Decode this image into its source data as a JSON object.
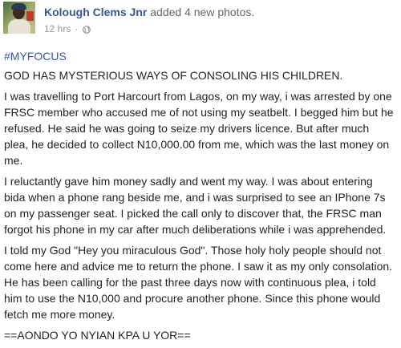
{
  "post": {
    "author_name": "Kolough Clems Jnr",
    "action": "added 4 new photos.",
    "timestamp": "12 hrs",
    "separator": "·",
    "privacy_icon": "globe-icon",
    "hashtag": "#MYFOCUS",
    "headline": "GOD HAS MYSTERIOUS WAYS OF CONSOLING HIS CHILDREN.",
    "paragraphs": [
      "I was travelling to Port Harcourt from Lagos, on my way, i was arrested by one FRSC member who accused me of not using my seatbelt. I begged him but he refused. He said he was going to seize my drivers licence. But after much plea, he decided to collect N10,000.00 from me, which was the last money on me.",
      "I reluctantly gave him money sadly and went my way. I was about entering bida when a phone rang beside me, and i was surprised to see an IPhone 7s on my passenger seat. I picked the call only to discover that, the FRSC man forgot his phone in my car after much deliberations while i was apprehended.",
      "I told my God \"Hey you miraculous God\". Those holy holy people should not come here and advice me to return the phone. I saw it as my only consolation. He has been calling for the past three days now with continuous plea, i told him to use the N10,000 and procure another phone. Since this phone would fetch me more money."
    ],
    "signoff": "==AONDO YO NYIAN KPA U YOR==",
    "colors": {
      "link": "#365899",
      "text": "#1d2129",
      "meta": "#90949c"
    }
  }
}
